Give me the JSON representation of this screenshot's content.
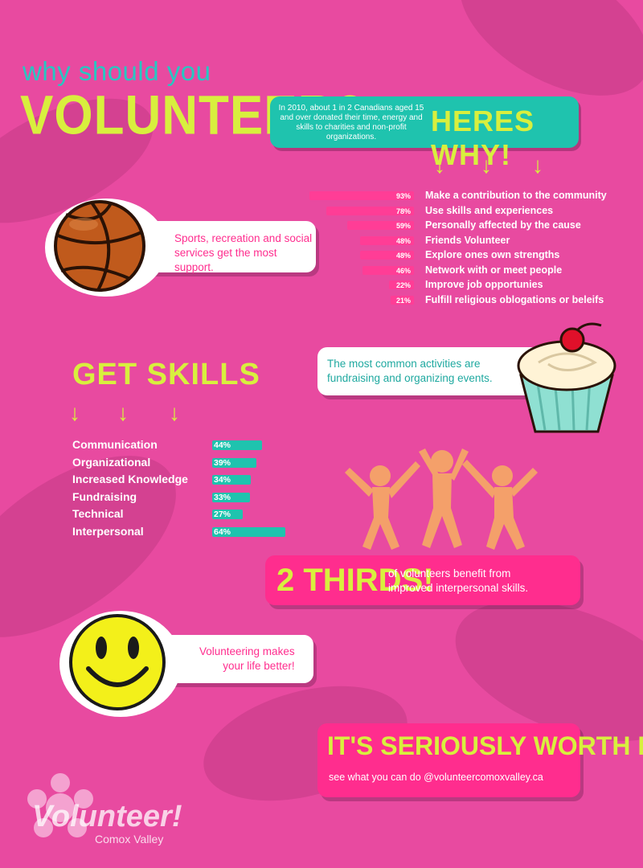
{
  "title": {
    "line1": "why should you",
    "line2": "VOLUNTEER?"
  },
  "heres": {
    "text": "In 2010, about 1 in 2 Canadians aged 15 and over donated their time, energy and skills to charities and non-profit organizations.",
    "title": "HERES WHY!"
  },
  "arrow_glyph": "↓",
  "reasons": [
    {
      "pct": "93%",
      "value": 93,
      "label": "Make a contribution to the community"
    },
    {
      "pct": "78%",
      "value": 78,
      "label": "Use skills and experiences"
    },
    {
      "pct": "59%",
      "value": 59,
      "label": "Personally affected by the cause"
    },
    {
      "pct": "48%",
      "value": 48,
      "label": "Friends Volunteer"
    },
    {
      "pct": "48%",
      "value": 48,
      "label": "Explore ones own strengths"
    },
    {
      "pct": "46%",
      "value": 46,
      "label": "Network with or meet people"
    },
    {
      "pct": "22%",
      "value": 22,
      "label": "Improve job opportunies"
    },
    {
      "pct": "21%",
      "value": 21,
      "label": "Fulfill religious oblogations or beleifs"
    }
  ],
  "sports": {
    "line1": "Sports, recreation and social",
    "line2": "services get the most support."
  },
  "activities": {
    "line1": "The most common activities are",
    "line2": "fundraising and organizing events."
  },
  "skills": {
    "title": "GET SKILLS",
    "items": [
      {
        "label": "Communication",
        "pct": "44%",
        "value": 44
      },
      {
        "label": "Organizational",
        "pct": "39%",
        "value": 39
      },
      {
        "label": "Increased Knowledge",
        "pct": "34%",
        "value": 34
      },
      {
        "label": "Fundraising",
        "pct": "33%",
        "value": 33
      },
      {
        "label": "Technical",
        "pct": "27%",
        "value": 27
      },
      {
        "label": "Interpersonal",
        "pct": "64%",
        "value": 64
      }
    ]
  },
  "thirds": {
    "title": "2 THIRDS!",
    "line1": "of volunteers benefit from",
    "line2": "improved interpersonal skills."
  },
  "life": {
    "line1": "Volunteering makes",
    "line2": "your life better!"
  },
  "worth": {
    "title": "IT'S SERIOUSLY WORTH IT!",
    "sub": "see what you can do @volunteercomoxvalley.ca"
  },
  "logo": {
    "name": "Volunteer!",
    "sub": "Comox Valley"
  },
  "colors": {
    "background": "#e84aa0",
    "teal": "#1fc3ae",
    "lime": "#d8ef3e",
    "hot_pink": "#ff2d8e"
  }
}
